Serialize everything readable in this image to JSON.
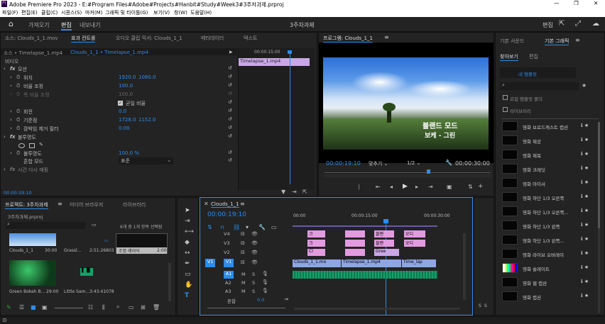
{
  "window": {
    "title": "Adobe Premiere Pro 2023 - E:#Program Files#Adobe#Projects#Hanbit#Study#Week3#3주차과제.prproj"
  },
  "menu": [
    "파일(F)",
    "편집(E)",
    "클립(C)",
    "시퀀스(S)",
    "마커(M)",
    "그래픽 및 타이틀(G)",
    "보기(V)",
    "창(W)",
    "도움말(H)"
  ],
  "workspace": {
    "tabs": [
      "가져오기",
      "편집",
      "내보내기"
    ],
    "active": "편집",
    "project_title": "3주차과제",
    "right_label": "편집"
  },
  "effect_controls": {
    "tabs": [
      "소스: Clouds_1_1.mov",
      "효과 컨트롤",
      "오디오 클립 믹서: Clouds_1_1",
      "메타데이터",
      "텍스트"
    ],
    "source": "소스 • Timelapse_1.mp4",
    "sequence_clip": "Clouds_1_1 • Timelapse_1.mp4",
    "section_video": "비디오",
    "motion": "모션",
    "position_label": "위치",
    "position_x": "1920.0",
    "position_y": "1080.0",
    "scale_label": "비율 조정",
    "scale_value": "100.0",
    "scale_w_label": "폭 비율 조정",
    "scale_w_value": "100.0",
    "uniform_label": "균일 비율",
    "rotation_label": "회전",
    "rotation_value": "0.0",
    "anchor_label": "기준점",
    "anchor_x": "1728.0",
    "anchor_y": "1152.0",
    "flicker_label": "깜박임 제거 필터",
    "flicker_value": "0.00",
    "opacity_section": "불투명도",
    "opacity_label": "불투명도",
    "opacity_value": "100.0 %",
    "blend_label": "혼합 모드",
    "blend_value": "표준",
    "time_remap": "시간 다시 매핑",
    "timecode": "00:00:19:10",
    "mini_ruler": "00:00:15:00",
    "mini_clip": "Timelapse_1.mp4"
  },
  "program": {
    "tab": "프로그램: Clouds_1_1",
    "overlay_line1": "블랜드 모드",
    "overlay_line2": "보케 - 그린",
    "timecode": "00:00:19:10",
    "fit": "맞추기",
    "quality": "1/2",
    "duration": "00:00:30:00"
  },
  "essential": {
    "tabs": [
      "기본 사운드",
      "기본 그래픽"
    ],
    "subtabs": [
      "찾아보기",
      "편집"
    ],
    "my_template": "내 템플릿",
    "local_only": "로컬 템플릿 폴더",
    "library": "라이브러리",
    "items": [
      "영화 브로드캐스트 캡션",
      "영화 제공",
      "영화 제목",
      "영화 크레딧",
      "영화 아이서",
      "영화 하단 1/3 오른쪽",
      "영화 하단 1/3 오른쪽...",
      "영화 하단 1/3 왼쪽",
      "영화 하단 1/3 왼쪽...",
      "영화 라이브 오버레이",
      "영화 슬레이트",
      "영화 웹 캡션",
      "영화 캡션"
    ]
  },
  "project": {
    "tabs": [
      "프로젝트: 3주차과제",
      "미디어 브라우저",
      "라이브러리"
    ],
    "file": "3주차과제.prproj",
    "count": "6개 중 1개 항목 선택됨",
    "items": [
      {
        "name": "Clouds_1_1",
        "dur": "30:00"
      },
      {
        "name": "Grassl...",
        "dur": "2:51:26803"
      },
      {
        "name": "조정 레이어",
        "dur": "2:00"
      },
      {
        "name": "Green Bokeh B...",
        "dur": "29:00"
      },
      {
        "name": "Little Sam...",
        "dur": "3:43:41078"
      }
    ]
  },
  "timeline": {
    "tab": "Clouds_1_1",
    "timecode": "00:00:19:10",
    "ruler": [
      "00:00",
      "00:00:15:00",
      "00:00:30:00"
    ],
    "video_tracks": [
      "V4",
      "V3",
      "V2",
      "V1"
    ],
    "audio_tracks": [
      "A1",
      "A2",
      "A3"
    ],
    "mix_label": "혼합",
    "mix_value": "0.0",
    "clips": {
      "v4a": "크",
      "v4b": "블랜",
      "v4c": "오디",
      "v3a": "크",
      "v3b": "블랜",
      "v3c": "오디",
      "v2a": "Cl",
      "v2b": "Gree",
      "v1a": "Clouds_1_1.mo",
      "v1b": "Timelapse_1.mp4",
      "v1c": "Time_lap",
      "v1track": "V1"
    },
    "meter_labels": [
      "S",
      "S"
    ]
  }
}
